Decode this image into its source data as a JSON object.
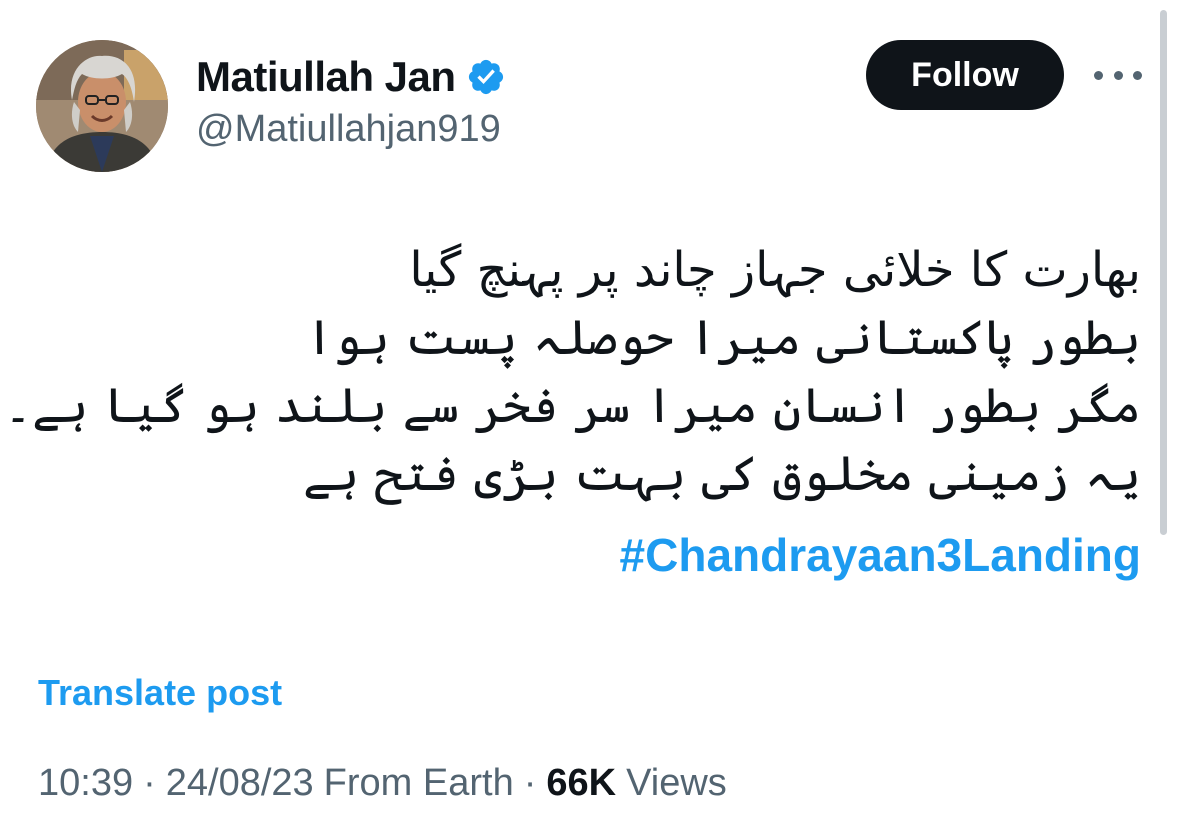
{
  "author": {
    "display_name": "Matiullah Jan",
    "handle": "@Matiullahjan919",
    "verified": true,
    "avatar_icon": "profile-photo"
  },
  "header": {
    "follow_label": "Follow",
    "more_icon": "more-horizontal-icon"
  },
  "tweet": {
    "lines": [
      "بھارت کا خلائی جہاز چاند پر پہنچ گیا",
      "بطور پاکستانی میرا حوصلہ پست ہوا",
      "مگر بطور انسان میرا سر فخر سے بلند ہو گیا ہے۔",
      "یہ زمینی مخلوق کی بہت بڑی فتح ہے"
    ],
    "hashtag": "#Chandrayaan3Landing"
  },
  "translate_label": "Translate post",
  "meta": {
    "time": "10:39",
    "date": "24/08/23",
    "source": "From Earth",
    "views_count": "66K",
    "views_label": "Views"
  },
  "colors": {
    "accent": "#1d9bf0",
    "text": "#0f1419",
    "muted": "#536471",
    "button_bg": "#0f1419"
  }
}
